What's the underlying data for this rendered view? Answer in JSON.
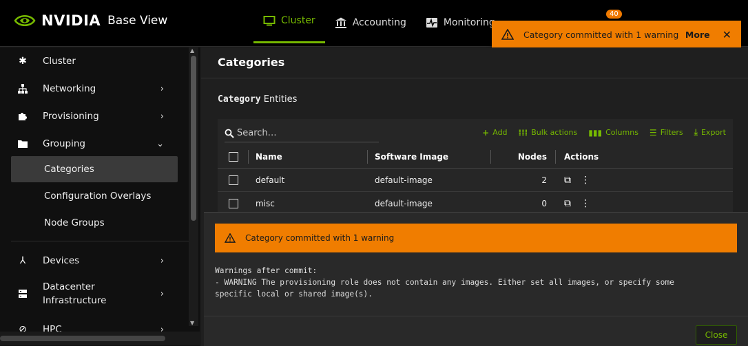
{
  "brand": {
    "name": "NVIDIA",
    "product": "Base View"
  },
  "topnav": {
    "items": [
      {
        "label": "Cluster",
        "icon": "monitor-icon",
        "active": true
      },
      {
        "label": "Accounting",
        "icon": "bank-icon",
        "active": false
      },
      {
        "label": "Monitoring",
        "icon": "pulse-icon",
        "active": false
      }
    ],
    "notification_count": "40"
  },
  "toast": {
    "message": "Category committed with 1 warning",
    "more_label": "More",
    "close_glyph": "✕"
  },
  "sidebar": {
    "items": [
      {
        "label": "Cluster",
        "icon": "cluster-icon",
        "chevron": ""
      },
      {
        "label": "Networking",
        "icon": "network-icon",
        "chevron": "›"
      },
      {
        "label": "Provisioning",
        "icon": "puzzle-icon",
        "chevron": "›"
      },
      {
        "label": "Grouping",
        "icon": "folder-icon",
        "chevron": "⌄"
      },
      {
        "label": "Devices",
        "icon": "devices-icon",
        "chevron": "›"
      },
      {
        "label": "Datacenter",
        "label2": "Infrastructure",
        "icon": "server-icon",
        "chevron": "›"
      },
      {
        "label": "HPC",
        "icon": "hpc-icon",
        "chevron": "›"
      }
    ],
    "subitems": [
      {
        "label": "Categories",
        "active": true
      },
      {
        "label": "Configuration Overlays",
        "active": false
      },
      {
        "label": "Node Groups",
        "active": false
      }
    ]
  },
  "main": {
    "title": "Categories",
    "entity_bold": "Category",
    "entity_rest": " Entities",
    "search_placeholder": "Search…",
    "toolbar": {
      "add": "Add",
      "bulk": "Bulk actions",
      "columns": "Columns",
      "filters": "Filters",
      "export": "Export"
    },
    "columns": [
      "Name",
      "Software Image",
      "Nodes",
      "Actions"
    ],
    "rows": [
      {
        "name": "default",
        "image": "default-image",
        "nodes": "2"
      },
      {
        "name": "misc",
        "image": "default-image",
        "nodes": "0"
      }
    ]
  },
  "panel": {
    "banner": "Category committed with 1 warning",
    "warnings_text": "Warnings after commit:\n- WARNING The provisioning role does not contain any images. Either set all images, or specify some\nspecific local or shared image(s).",
    "close_label": "Close"
  },
  "colors": {
    "accent": "#76b900",
    "warning": "#f07d00"
  }
}
